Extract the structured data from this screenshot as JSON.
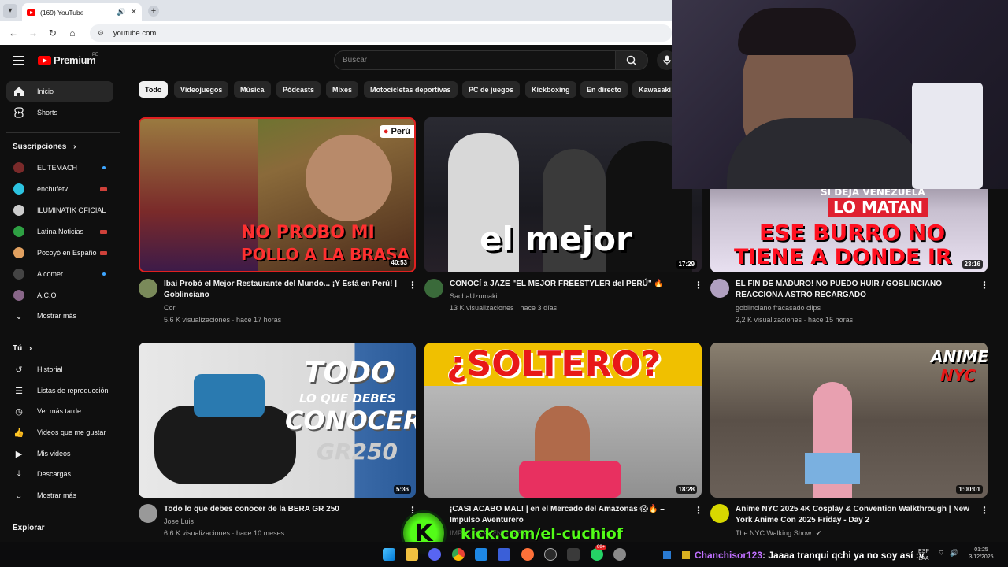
{
  "browser": {
    "tab_title": "(169) YouTube",
    "url": "youtube.com",
    "new_tab_glyph": "+",
    "tab_close_glyph": "✕"
  },
  "masthead": {
    "logo_text": "Premium",
    "region": "PE",
    "search_placeholder": "Buscar"
  },
  "sidebar": {
    "main": [
      {
        "label": "Inicio",
        "icon": "home-icon"
      },
      {
        "label": "Shorts",
        "icon": "shorts-icon"
      }
    ],
    "subscriptions_heading": "Suscripciones",
    "subscriptions": [
      {
        "label": "EL TEMACH",
        "color": "#7a2a2a",
        "badge": "dot"
      },
      {
        "label": "enchufetv",
        "color": "#2cc3e0",
        "badge": "live"
      },
      {
        "label": "ILUMINATIK OFICIAL",
        "color": "#cccccc",
        "badge": ""
      },
      {
        "label": "Latina Noticias",
        "color": "#2ea043",
        "badge": "live"
      },
      {
        "label": "Pocoyó en Español -...",
        "color": "#e0a060",
        "badge": "live"
      },
      {
        "label": "A comer",
        "color": "#444444",
        "badge": "dot"
      },
      {
        "label": "A.C.O",
        "color": "#886688",
        "badge": ""
      },
      {
        "label": "Mostrar más",
        "color": "",
        "badge": ""
      }
    ],
    "you_heading": "Tú",
    "you_items": [
      {
        "label": "Historial",
        "icon": "history-icon"
      },
      {
        "label": "Listas de reproducción",
        "icon": "playlists-icon"
      },
      {
        "label": "Ver más tarde",
        "icon": "watch-later-icon"
      },
      {
        "label": "Videos que me gustan",
        "icon": "like-icon"
      },
      {
        "label": "Mis videos",
        "icon": "my-videos-icon"
      },
      {
        "label": "Descargas",
        "icon": "download-icon"
      },
      {
        "label": "Mostrar más",
        "icon": "chevron-down-icon"
      }
    ],
    "explore_heading": "Explorar"
  },
  "chips": [
    "Todo",
    "Videojuegos",
    "Música",
    "Pódcasts",
    "Mixes",
    "Motocicletas deportivas",
    "PC de juegos",
    "Kickboxing",
    "En directo",
    "Kawasaki"
  ],
  "videos": [
    {
      "title_line1": "Ibai Probó el Mejor Restaurante del Mundo... ¡Y Está en Perú! |",
      "title_line2": "Goblinciano",
      "channel": "Cori",
      "meta": "5,6 K visualizaciones · hace 17 horas",
      "duration": "40:53",
      "overlay": [
        "NO PROBO MI",
        "POLLO A LA BRASA"
      ],
      "tag": "Perú",
      "avatar_color": "#7a8a5a"
    },
    {
      "title_line1": "CONOCÍ a JAZE \"EL MEJOR FREESTYLER del PERÚ\" 🔥",
      "title_line2": "",
      "channel": "SachaUzumaki",
      "meta": "13 K visualizaciones · hace 3 días",
      "duration": "17:29",
      "overlay": [
        "el mejor"
      ],
      "avatar_color": "#3a6a3a"
    },
    {
      "title_line1": "EL FIN DE MADURO! NO PUEDO HUIR / GOBLINCIANO",
      "title_line2": "REACCIONA ASTRO RECARGADO",
      "channel": "goblinciano fracasado clips",
      "meta": "2,2 K visualizaciones · hace 15 horas",
      "duration": "23:16",
      "overlay": [
        "SI DEJA VENEZUELA",
        "LO MATAN",
        "ESE BURRO NO",
        "TIENE A DONDE IR"
      ],
      "avatar_color": "#b0a0c0"
    },
    {
      "title_line1": "Todo lo que debes conocer de la BERA GR 250",
      "title_line2": "",
      "channel": "Jose Luis",
      "meta": "6,6 K visualizaciones · hace 10 meses",
      "duration": "5:36",
      "overlay": [
        "TODO",
        "LO QUE DEBES",
        "CONOCER",
        "GR250"
      ],
      "avatar_color": "#999999"
    },
    {
      "title_line1": "¡CASI ACABO MAL! | en el Mercado del Amazonas 😱🔥 –",
      "title_line2": "Impulso Aventurero",
      "channel": "IMPULSO AVENTURERO",
      "meta": "",
      "duration": "18:28",
      "overlay": [
        "¿SOLTERO?"
      ],
      "avatar_color": "#555555"
    },
    {
      "title_line1": "Anime NYC 2025 4K Cosplay & Convention Walkthrough | New",
      "title_line2": "York Anime Con 2025 Friday - Day 2",
      "channel": "The NYC Walking Show",
      "meta": "",
      "duration": "1:00:01",
      "overlay": [
        "ANIME",
        "NYC"
      ],
      "avatar_color": "#d8d800"
    }
  ],
  "stream_overlay": {
    "kick_url": "kick.com/el-cuchiof",
    "chat_user": "Chanchisor123",
    "chat_message": ": Jaaaa tranqui qchi ya no soy así :v"
  },
  "taskbar": {
    "lang_top": "ESP",
    "lang_bottom": "LAA",
    "time": "01:25",
    "date": "3/12/2025",
    "badge": "99+"
  },
  "colors": {
    "brand_red": "#ff0000",
    "bg": "#0f0f0f",
    "chip_bg": "#272727",
    "kick_green": "#53fc18"
  }
}
